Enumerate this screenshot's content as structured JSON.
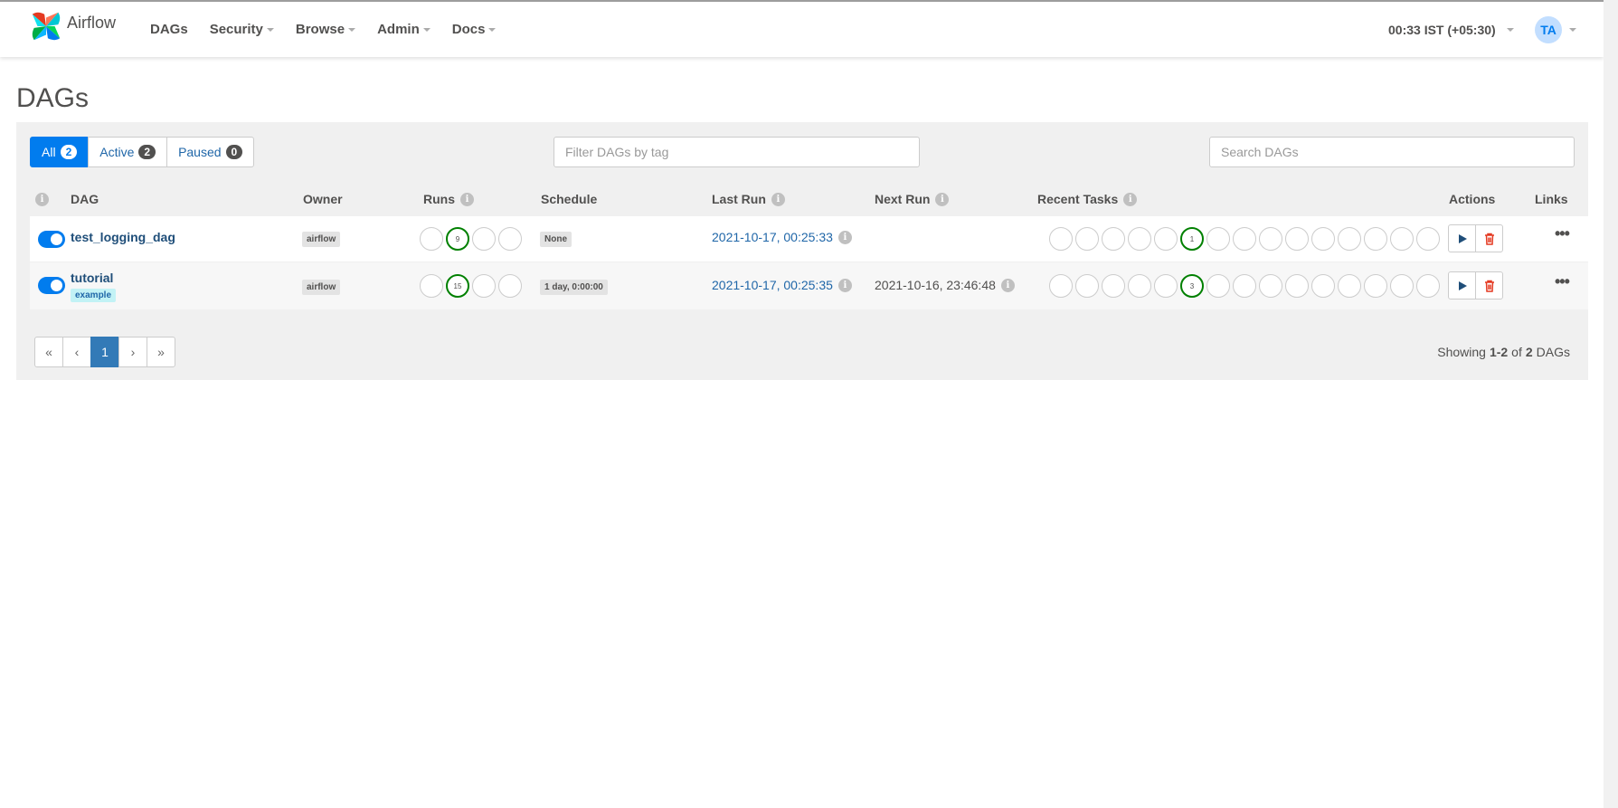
{
  "navbar": {
    "brand": "Airflow",
    "items": [
      {
        "label": "DAGs",
        "caret": false
      },
      {
        "label": "Security",
        "caret": true
      },
      {
        "label": "Browse",
        "caret": true
      },
      {
        "label": "Admin",
        "caret": true
      },
      {
        "label": "Docs",
        "caret": true
      }
    ],
    "clock": "00:33 IST (+05:30)",
    "user_initials": "TA"
  },
  "page": {
    "title": "DAGs"
  },
  "filters": {
    "all": {
      "label": "All",
      "count": "2"
    },
    "active": {
      "label": "Active",
      "count": "2"
    },
    "paused": {
      "label": "Paused",
      "count": "0"
    },
    "tag_placeholder": "Filter DAGs by tag",
    "search_placeholder": "Search DAGs"
  },
  "table": {
    "headers": {
      "dag": "DAG",
      "owner": "Owner",
      "runs": "Runs",
      "schedule": "Schedule",
      "last_run": "Last Run",
      "next_run": "Next Run",
      "recent_tasks": "Recent Tasks",
      "actions": "Actions",
      "links": "Links"
    },
    "rows": [
      {
        "dag_id": "test_logging_dag",
        "tags": [],
        "owner": "airflow",
        "runs": [
          "",
          "9",
          "",
          ""
        ],
        "schedule": "None",
        "last_run": "2021-10-17, 00:25:33",
        "next_run": "",
        "recent_tasks": [
          "",
          "",
          "",
          "",
          "",
          "1",
          "",
          "",
          "",
          "",
          "",
          "",
          "",
          "",
          ""
        ]
      },
      {
        "dag_id": "tutorial",
        "tags": [
          "example"
        ],
        "owner": "airflow",
        "runs": [
          "",
          "15",
          "",
          ""
        ],
        "schedule": "1 day, 0:00:00",
        "last_run": "2021-10-17, 00:25:35",
        "next_run": "2021-10-16, 23:46:48",
        "recent_tasks": [
          "",
          "",
          "",
          "",
          "",
          "3",
          "",
          "",
          "",
          "",
          "",
          "",
          "",
          "",
          ""
        ]
      }
    ]
  },
  "pagination": {
    "first": "«",
    "prev": "‹",
    "current": "1",
    "next": "›",
    "last": "»"
  },
  "showing": {
    "prefix": "Showing",
    "range": "1-2",
    "of": "of",
    "total": "2",
    "suffix": "DAGs"
  },
  "colors": {
    "primary": "#017cee",
    "success": "#008000",
    "danger": "#e43921",
    "link": "#1f66a8"
  },
  "icons": {
    "play": "play-icon",
    "delete": "trash-icon",
    "links": "ellipsis-icon",
    "info": "info-icon"
  }
}
